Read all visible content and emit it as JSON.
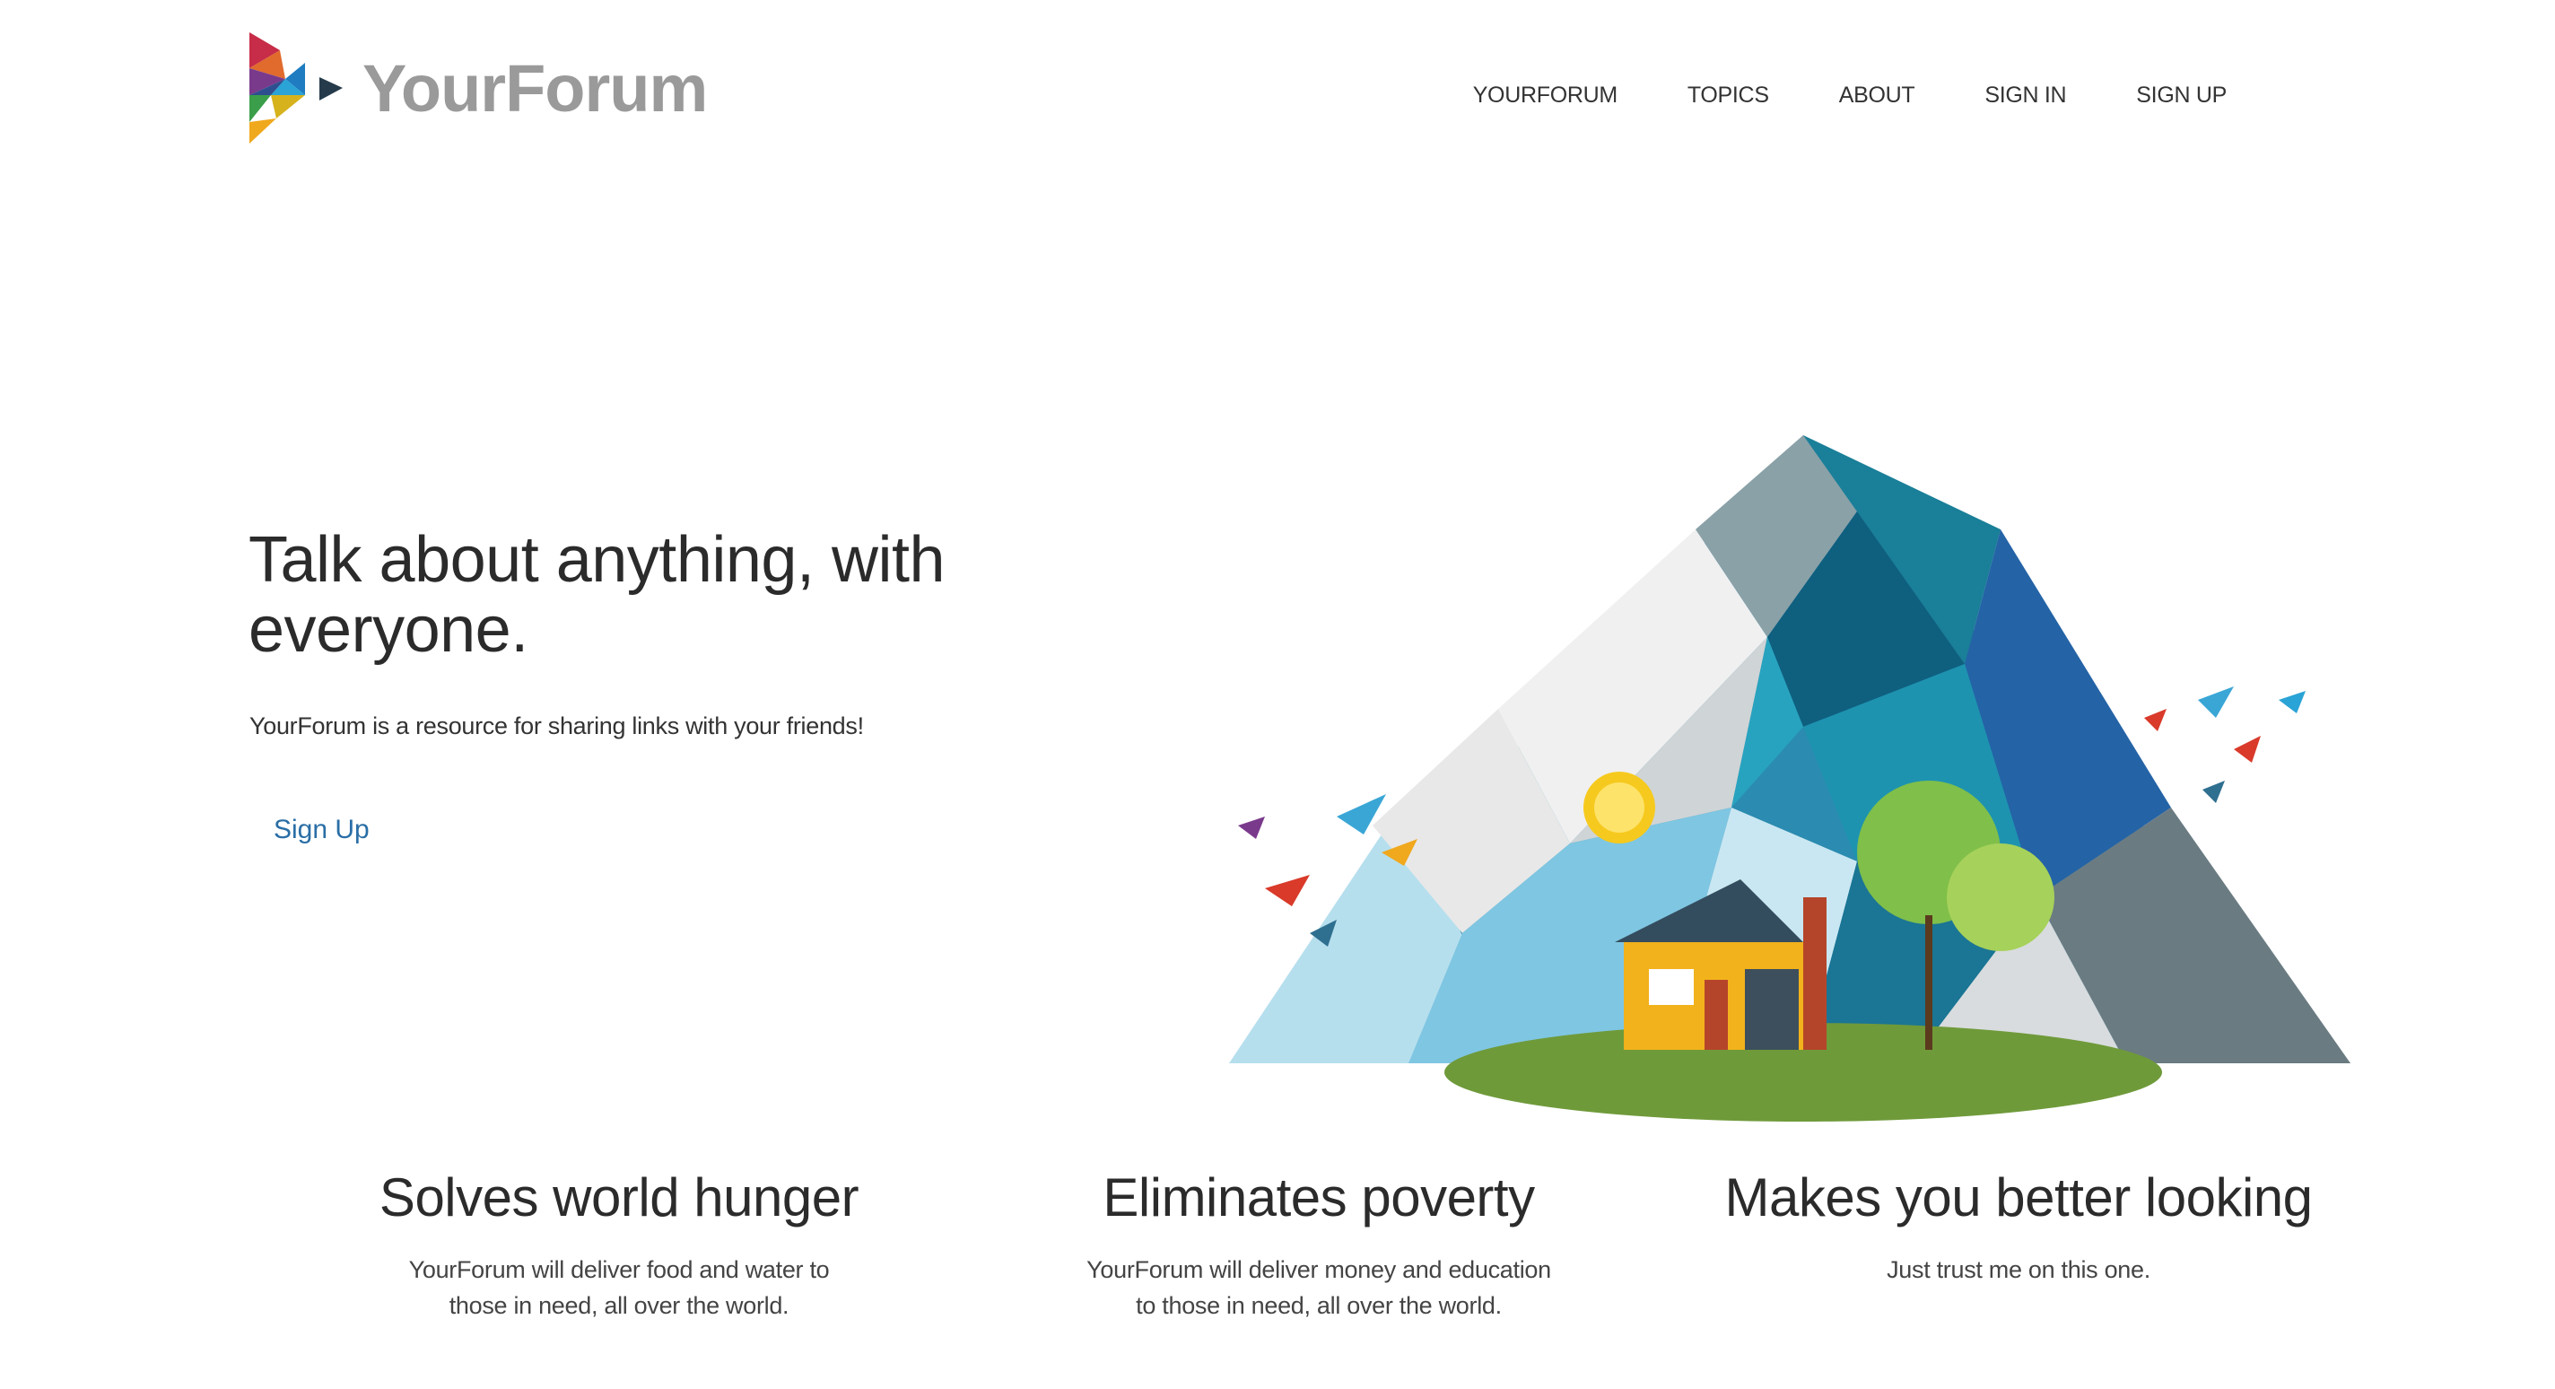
{
  "brand": {
    "name": "YourForum",
    "logo_icon": "triangle-mosaic-logo-icon"
  },
  "nav": {
    "items": [
      "YOURFORUM",
      "TOPICS",
      "ABOUT",
      "SIGN IN",
      "SIGN UP"
    ]
  },
  "hero": {
    "title": "Talk about anything, with everyone.",
    "subtitle": "YourForum is a resource for sharing links with your friends!",
    "cta_label": "Sign Up",
    "illustration_icon": "mountain-house-illustration"
  },
  "features": [
    {
      "title": "Solves world hunger",
      "text": "YourForum will deliver food and water to those in need, all over the world."
    },
    {
      "title": "Eliminates poverty",
      "text": "YourForum will deliver money and education to those in need, all over the world."
    },
    {
      "title": "Makes you better looking",
      "text": "Just trust me on this one."
    }
  ],
  "colors": {
    "link": "#2a6ea6",
    "logo_text": "#9a9a9a",
    "heading": "#2b2b2b"
  }
}
